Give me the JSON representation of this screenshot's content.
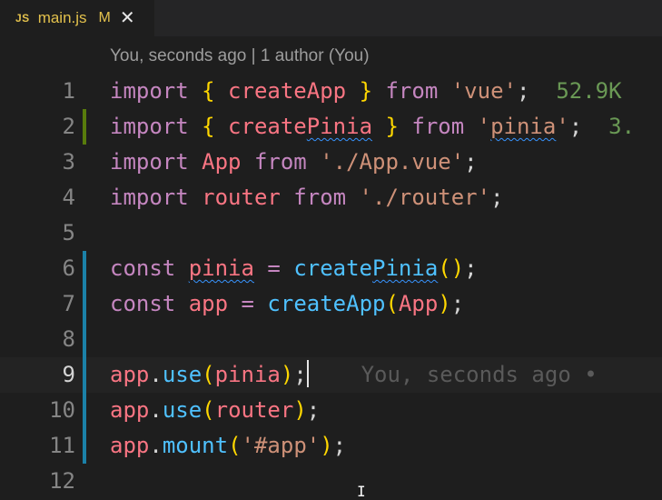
{
  "tab": {
    "icon_text": "JS",
    "filename": "main.js",
    "status": "M",
    "close_glyph": "✕"
  },
  "codelens": "You, seconds ago | 1 author (You)",
  "lines": [
    {
      "num": "1",
      "tokens": [
        {
          "t": "import",
          "c": "kw"
        },
        {
          "t": " ",
          "c": "punc"
        },
        {
          "t": "{",
          "c": "br1"
        },
        {
          "t": " createApp ",
          "c": "var"
        },
        {
          "t": "}",
          "c": "br1"
        },
        {
          "t": " ",
          "c": "punc"
        },
        {
          "t": "from",
          "c": "kw"
        },
        {
          "t": " ",
          "c": "punc"
        },
        {
          "t": "'vue'",
          "c": "str"
        },
        {
          "t": ";",
          "c": "punc"
        },
        {
          "t": "  52.9K",
          "c": "size"
        }
      ]
    },
    {
      "num": "2",
      "tokens": [
        {
          "t": "import",
          "c": "kw"
        },
        {
          "t": " ",
          "c": "punc"
        },
        {
          "t": "{",
          "c": "br1"
        },
        {
          "t": " create",
          "c": "var"
        },
        {
          "t": "Pinia",
          "c": "var squig"
        },
        {
          "t": " ",
          "c": "var"
        },
        {
          "t": "}",
          "c": "br1"
        },
        {
          "t": " ",
          "c": "punc"
        },
        {
          "t": "from",
          "c": "kw"
        },
        {
          "t": " ",
          "c": "punc"
        },
        {
          "t": "'",
          "c": "str"
        },
        {
          "t": "pinia",
          "c": "str squig"
        },
        {
          "t": "'",
          "c": "str"
        },
        {
          "t": ";",
          "c": "punc"
        },
        {
          "t": "  3.",
          "c": "size"
        }
      ]
    },
    {
      "num": "3",
      "tokens": [
        {
          "t": "import",
          "c": "kw"
        },
        {
          "t": " App ",
          "c": "var"
        },
        {
          "t": "from",
          "c": "kw"
        },
        {
          "t": " ",
          "c": "punc"
        },
        {
          "t": "'./App.vue'",
          "c": "str"
        },
        {
          "t": ";",
          "c": "punc"
        }
      ]
    },
    {
      "num": "4",
      "tokens": [
        {
          "t": "import",
          "c": "kw"
        },
        {
          "t": " router ",
          "c": "var"
        },
        {
          "t": "from",
          "c": "kw"
        },
        {
          "t": " ",
          "c": "punc"
        },
        {
          "t": "'./router'",
          "c": "str"
        },
        {
          "t": ";",
          "c": "punc"
        }
      ]
    },
    {
      "num": "5",
      "tokens": []
    },
    {
      "num": "6",
      "tokens": [
        {
          "t": "const",
          "c": "kw"
        },
        {
          "t": " ",
          "c": "punc"
        },
        {
          "t": "pinia",
          "c": "var squig"
        },
        {
          "t": " ",
          "c": "punc"
        },
        {
          "t": "=",
          "c": "kw"
        },
        {
          "t": " ",
          "c": "punc"
        },
        {
          "t": "create",
          "c": "fn"
        },
        {
          "t": "Pinia",
          "c": "fn squig"
        },
        {
          "t": "(",
          "c": "br1"
        },
        {
          "t": ")",
          "c": "br1"
        },
        {
          "t": ";",
          "c": "punc"
        }
      ]
    },
    {
      "num": "7",
      "tokens": [
        {
          "t": "const",
          "c": "kw"
        },
        {
          "t": " ",
          "c": "punc"
        },
        {
          "t": "app",
          "c": "var"
        },
        {
          "t": " ",
          "c": "punc"
        },
        {
          "t": "=",
          "c": "kw"
        },
        {
          "t": " ",
          "c": "punc"
        },
        {
          "t": "createApp",
          "c": "fn"
        },
        {
          "t": "(",
          "c": "br1"
        },
        {
          "t": "App",
          "c": "var"
        },
        {
          "t": ")",
          "c": "br1"
        },
        {
          "t": ";",
          "c": "punc"
        }
      ]
    },
    {
      "num": "8",
      "tokens": []
    },
    {
      "num": "9",
      "current": true,
      "tokens": [
        {
          "t": "app",
          "c": "var"
        },
        {
          "t": ".",
          "c": "punc"
        },
        {
          "t": "use",
          "c": "fn"
        },
        {
          "t": "(",
          "c": "br1"
        },
        {
          "t": "pinia",
          "c": "var"
        },
        {
          "t": ")",
          "c": "br1"
        },
        {
          "t": ";",
          "c": "punc"
        }
      ],
      "blame": "You, seconds ago •"
    },
    {
      "num": "10",
      "tokens": [
        {
          "t": "app",
          "c": "var"
        },
        {
          "t": ".",
          "c": "punc"
        },
        {
          "t": "use",
          "c": "fn"
        },
        {
          "t": "(",
          "c": "br1"
        },
        {
          "t": "router",
          "c": "var"
        },
        {
          "t": ")",
          "c": "br1"
        },
        {
          "t": ";",
          "c": "punc"
        }
      ]
    },
    {
      "num": "11",
      "tokens": [
        {
          "t": "app",
          "c": "var"
        },
        {
          "t": ".",
          "c": "punc"
        },
        {
          "t": "mount",
          "c": "fn"
        },
        {
          "t": "(",
          "c": "br1"
        },
        {
          "t": "'#app'",
          "c": "str"
        },
        {
          "t": ")",
          "c": "br1"
        },
        {
          "t": ";",
          "c": "punc"
        }
      ]
    },
    {
      "num": "12",
      "tokens": []
    }
  ],
  "colors": {
    "added": "#587c0c",
    "modified": "#1b81a8"
  }
}
